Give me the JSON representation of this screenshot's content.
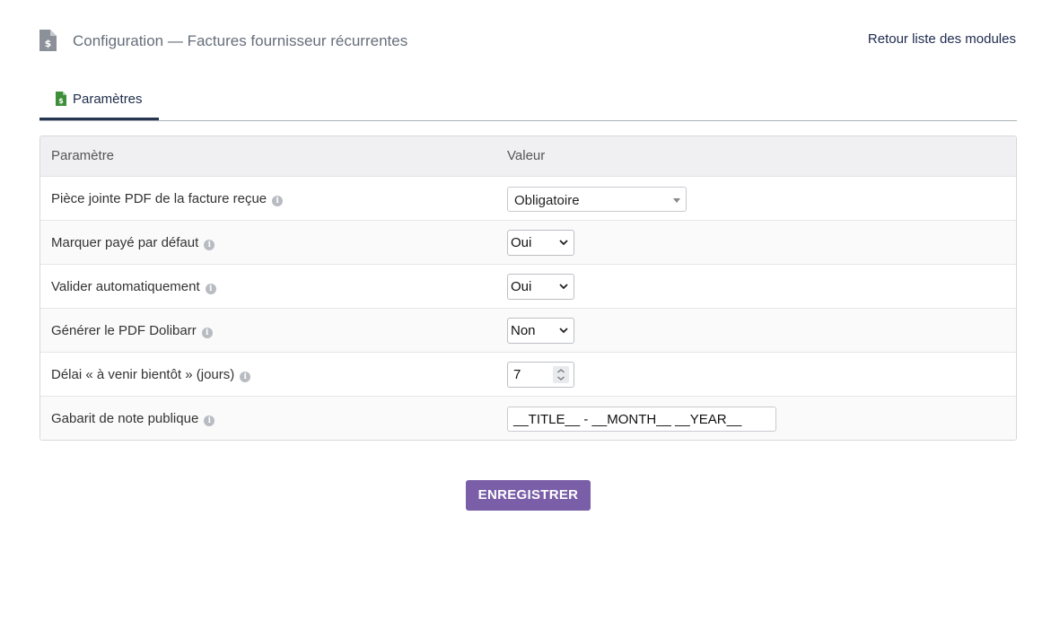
{
  "header": {
    "title": "Configuration — Factures fournisseur récurrentes",
    "icon": "invoice-dollar-icon",
    "back_link": "Retour liste des modules"
  },
  "tabs": [
    {
      "label": "Paramètres",
      "icon": "invoice-dollar-icon",
      "active": true
    }
  ],
  "table": {
    "headers": {
      "param": "Paramètre",
      "value": "Valeur"
    },
    "rows": [
      {
        "label": "Pièce jointe PDF de la facture reçue",
        "control": "select",
        "value": "Obligatoire"
      },
      {
        "label": "Marquer payé par défaut",
        "control": "select",
        "value": "Oui"
      },
      {
        "label": "Valider automatiquement",
        "control": "select",
        "value": "Oui"
      },
      {
        "label": "Générer le PDF Dolibarr",
        "control": "select",
        "value": "Non"
      },
      {
        "label": "Délai « à venir bientôt » (jours)",
        "control": "number",
        "value": "7"
      },
      {
        "label": "Gabarit de note publique",
        "control": "text",
        "value": "__TITLE__ - __MONTH__ __YEAR__"
      }
    ]
  },
  "save_button": {
    "label": "ENREGISTRER"
  },
  "colors": {
    "accent": "#7a5fa8",
    "link": "#1e2b4e",
    "icon_gray": "#8b9099",
    "icon_green": "#3f8f3a"
  }
}
